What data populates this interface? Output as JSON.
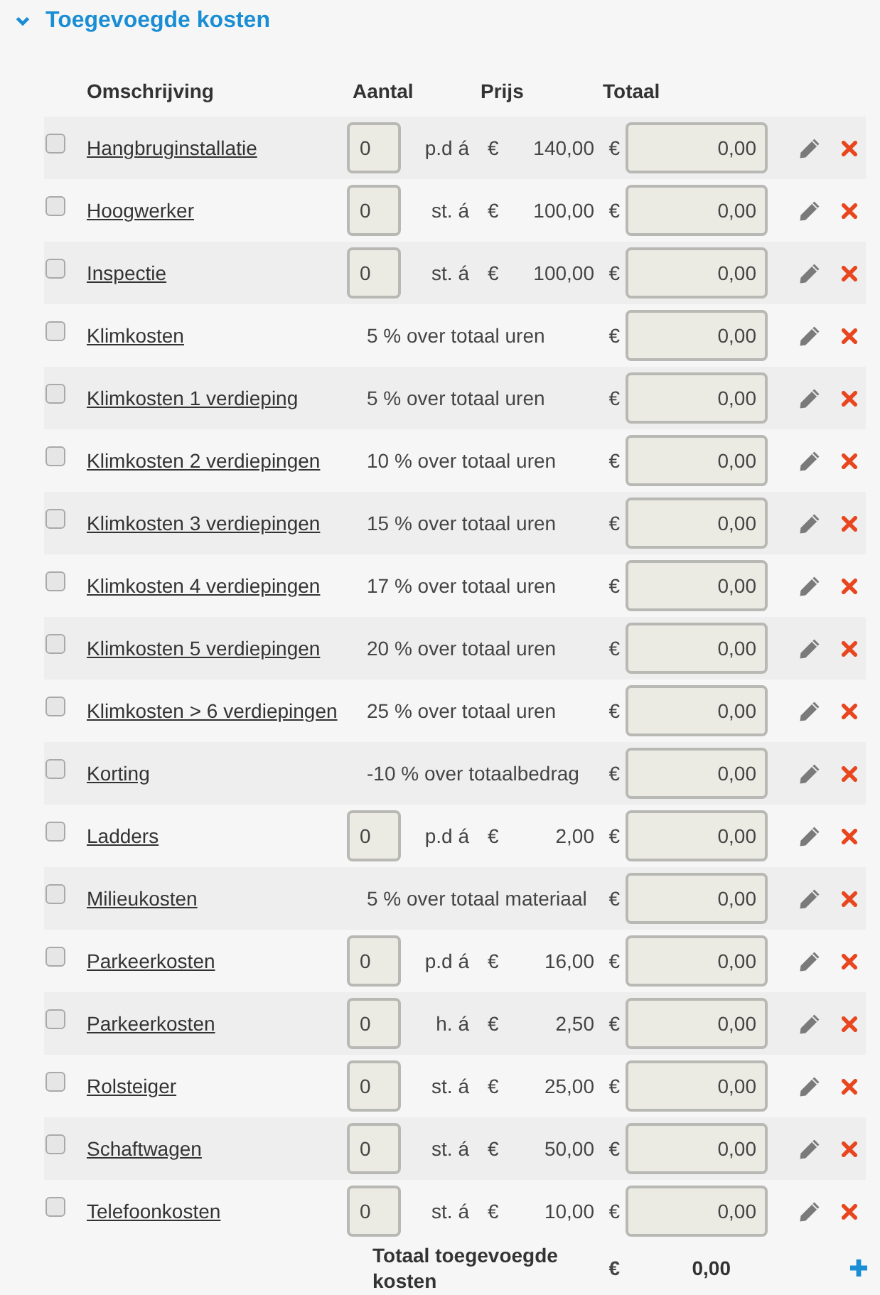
{
  "section": {
    "title": "Toegevoegde kosten",
    "expanded": true
  },
  "columns": [
    "Omschrijving",
    "Aantal",
    "Prijs",
    "Totaal"
  ],
  "rows": [
    {
      "kind": "unit",
      "checked": false,
      "name": "Hangbruginstallatie",
      "quantity": "0",
      "unit": "p.d á",
      "price_currency": "€",
      "price": "140,00",
      "total_currency": "€",
      "total": "0,00"
    },
    {
      "kind": "unit",
      "checked": false,
      "name": "Hoogwerker",
      "quantity": "0",
      "unit": "st. á",
      "price_currency": "€",
      "price": "100,00",
      "total_currency": "€",
      "total": "0,00"
    },
    {
      "kind": "unit",
      "checked": false,
      "name": "Inspectie",
      "quantity": "0",
      "unit": "st. á",
      "price_currency": "€",
      "price": "100,00",
      "total_currency": "€",
      "total": "0,00"
    },
    {
      "kind": "percentage",
      "checked": false,
      "name": "Klimkosten",
      "description": "5 % over totaal uren",
      "total_currency": "€",
      "total": "0,00"
    },
    {
      "kind": "percentage",
      "checked": false,
      "name": "Klimkosten 1 verdieping",
      "description": "5 % over totaal uren",
      "total_currency": "€",
      "total": "0,00"
    },
    {
      "kind": "percentage",
      "checked": false,
      "name": "Klimkosten 2 verdiepingen",
      "description": "10 % over totaal uren",
      "total_currency": "€",
      "total": "0,00"
    },
    {
      "kind": "percentage",
      "checked": false,
      "name": "Klimkosten 3 verdiepingen",
      "description": "15 % over totaal uren",
      "total_currency": "€",
      "total": "0,00"
    },
    {
      "kind": "percentage",
      "checked": false,
      "name": "Klimkosten 4 verdiepingen",
      "description": "17 % over totaal uren",
      "total_currency": "€",
      "total": "0,00"
    },
    {
      "kind": "percentage",
      "checked": false,
      "name": "Klimkosten 5 verdiepingen",
      "description": "20 % over totaal uren",
      "total_currency": "€",
      "total": "0,00"
    },
    {
      "kind": "percentage",
      "checked": false,
      "name": "Klimkosten > 6 verdiepingen",
      "description": "25 % over totaal uren",
      "total_currency": "€",
      "total": "0,00"
    },
    {
      "kind": "percentage",
      "checked": false,
      "name": "Korting",
      "description": "-10 % over totaalbedrag",
      "total_currency": "€",
      "total": "0,00"
    },
    {
      "kind": "unit",
      "checked": false,
      "name": "Ladders",
      "quantity": "0",
      "unit": "p.d á",
      "price_currency": "€",
      "price": "2,00",
      "total_currency": "€",
      "total": "0,00"
    },
    {
      "kind": "percentage",
      "checked": false,
      "name": "Milieukosten",
      "description": "5 % over totaal materiaal",
      "total_currency": "€",
      "total": "0,00"
    },
    {
      "kind": "unit",
      "checked": false,
      "name": "Parkeerkosten",
      "quantity": "0",
      "unit": "p.d á",
      "price_currency": "€",
      "price": "16,00",
      "total_currency": "€",
      "total": "0,00"
    },
    {
      "kind": "unit",
      "checked": false,
      "name": "Parkeerkosten",
      "quantity": "0",
      "unit": "h. á",
      "price_currency": "€",
      "price": "2,50",
      "total_currency": "€",
      "total": "0,00"
    },
    {
      "kind": "unit",
      "checked": false,
      "name": "Rolsteiger",
      "quantity": "0",
      "unit": "st. á",
      "price_currency": "€",
      "price": "25,00",
      "total_currency": "€",
      "total": "0,00"
    },
    {
      "kind": "unit",
      "checked": false,
      "name": "Schaftwagen",
      "quantity": "0",
      "unit": "st. á",
      "price_currency": "€",
      "price": "50,00",
      "total_currency": "€",
      "total": "0,00"
    },
    {
      "kind": "unit",
      "checked": false,
      "name": "Telefoonkosten",
      "quantity": "0",
      "unit": "st. á",
      "price_currency": "€",
      "price": "10,00",
      "total_currency": "€",
      "total": "0,00"
    }
  ],
  "footer": {
    "label": "Totaal toegevoegde kosten",
    "currency": "€",
    "total": "0,00"
  }
}
